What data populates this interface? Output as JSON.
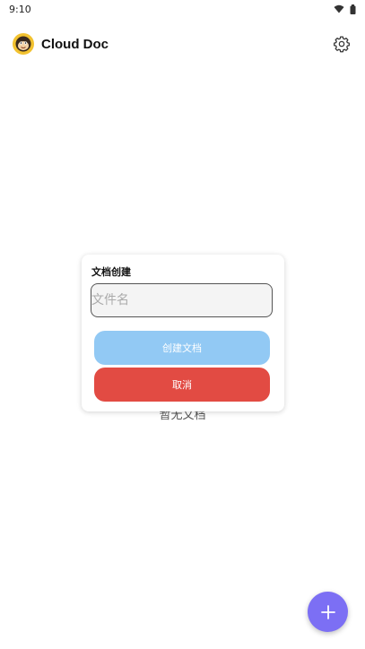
{
  "status_bar": {
    "time": "9:10",
    "icons": [
      "wifi-icon",
      "battery-icon"
    ]
  },
  "header": {
    "app_title": "Cloud Doc",
    "logo_icon": "monkey-logo-icon",
    "settings_icon": "gear-icon"
  },
  "main": {
    "empty_text": "暂无文档"
  },
  "dialog": {
    "title": "文档创建",
    "input_placeholder": "文件名",
    "input_value": "",
    "create_label": "创建文档",
    "cancel_label": "取消"
  },
  "fab": {
    "icon": "plus-icon"
  },
  "colors": {
    "create_button": "#92c9f4",
    "cancel_button": "#e24b43",
    "fab": "#7c6ff4",
    "logo": "#f2c230"
  }
}
